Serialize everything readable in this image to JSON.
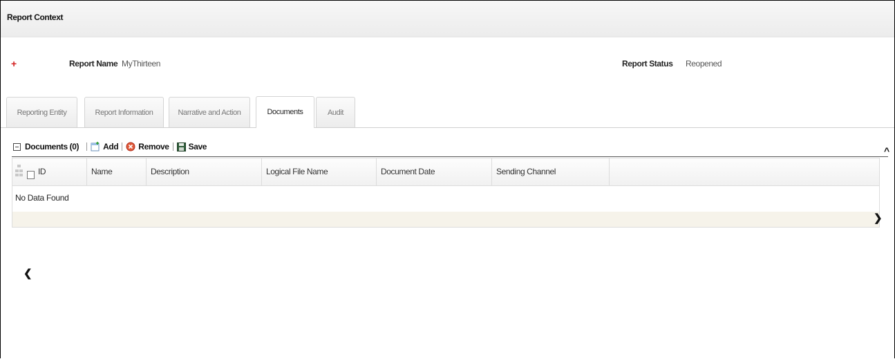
{
  "header": {
    "title": "Report Context"
  },
  "report": {
    "name_label": "Report Name",
    "name_value": "MyThirteen",
    "status_label": "Report Status",
    "status_value": "Reopened",
    "expand_symbol": "+"
  },
  "tabs": [
    {
      "label": "Reporting Entity",
      "active": false
    },
    {
      "label": "Report Information",
      "active": false
    },
    {
      "label": "Narrative and Action",
      "active": false
    },
    {
      "label": "Documents",
      "active": true
    },
    {
      "label": "Audit",
      "active": false
    }
  ],
  "documents": {
    "title": "Documents (0)",
    "add_label": "Add",
    "remove_label": "Remove",
    "save_label": "Save",
    "columns": [
      "ID",
      "Name",
      "Description",
      "Logical File Name",
      "Document Date",
      "Sending Channel"
    ],
    "empty_text": "No Data Found"
  },
  "glyphs": {
    "scroll_up": "^",
    "scroll_left": "❮",
    "scroll_right": "❯"
  },
  "colors": {
    "accent_red": "#d21c1c",
    "scrollbar": "#f6f3ea"
  }
}
